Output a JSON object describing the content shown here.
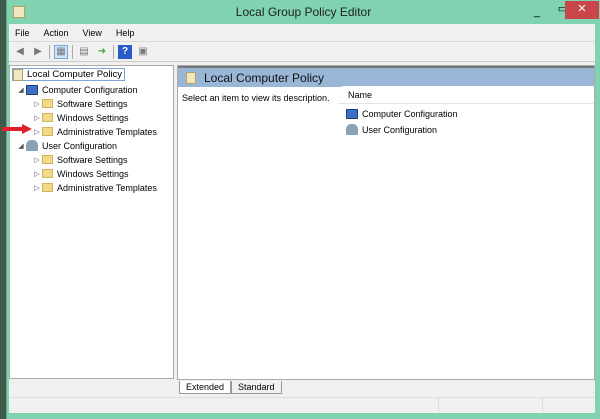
{
  "window": {
    "title": "Local Group Policy Editor",
    "minimize": "_",
    "maximize": "▭",
    "close": "✕"
  },
  "menu": [
    "File",
    "Action",
    "View",
    "Help"
  ],
  "tree": {
    "root": "Local Computer Policy",
    "computer": {
      "label": "Computer Configuration",
      "children": [
        "Software Settings",
        "Windows Settings",
        "Administrative Templates"
      ]
    },
    "user": {
      "label": "User Configuration",
      "children": [
        "Software Settings",
        "Windows Settings",
        "Administrative Templates"
      ]
    }
  },
  "details": {
    "header": "Local Computer Policy",
    "description": "Select an item to view its description.",
    "column": "Name",
    "items": [
      "Computer Configuration",
      "User Configuration"
    ]
  },
  "tabs": [
    "Extended",
    "Standard"
  ],
  "colors": {
    "frame": "#7fd3b0",
    "close": "#c9474b",
    "header": "#9ab6d6",
    "arrow": "#e0202a"
  }
}
